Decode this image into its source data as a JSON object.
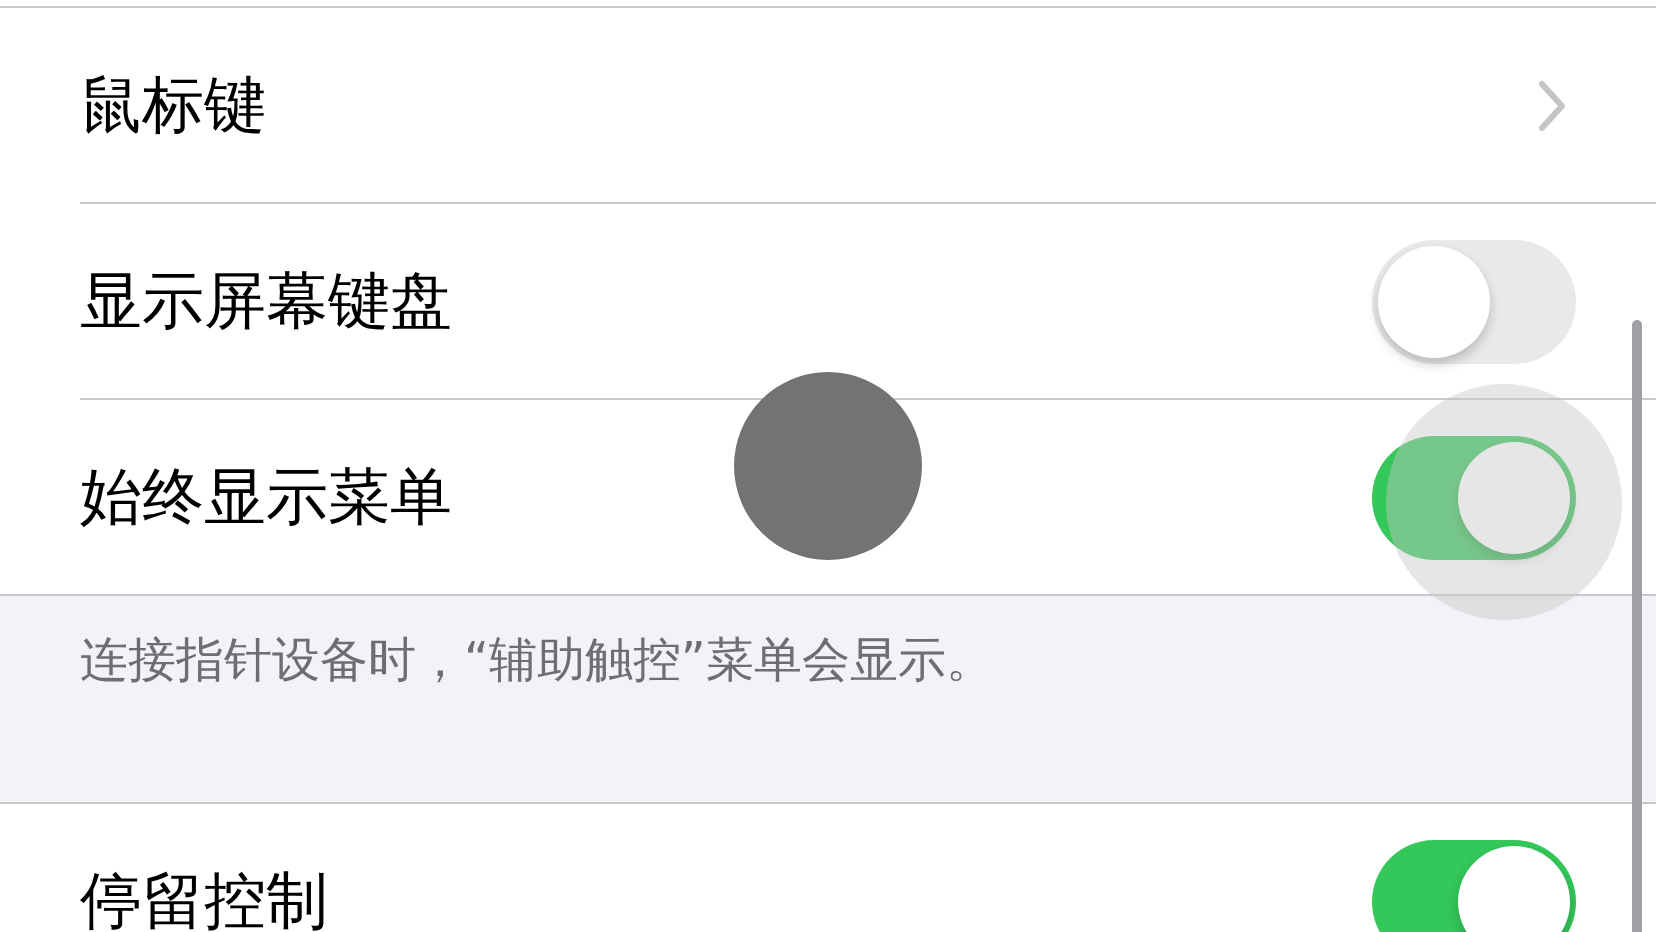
{
  "groups": [
    {
      "rows": [
        {
          "kind": "chevron",
          "label": "鼠标键"
        },
        {
          "kind": "toggle",
          "label": "显示屏幕键盘",
          "on": false
        },
        {
          "kind": "toggle",
          "label": "始终显示菜单",
          "on": true
        }
      ],
      "footer": "连接指针设备时，“辅助触控”菜单会显示。"
    },
    {
      "rows": [
        {
          "kind": "toggle",
          "label": "停留控制",
          "on": true
        }
      ]
    }
  ]
}
